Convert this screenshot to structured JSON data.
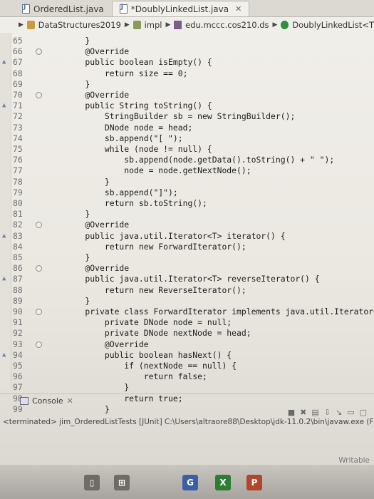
{
  "tabs": [
    {
      "label": "OrderedList.java",
      "active": false
    },
    {
      "label": "*DoublyLinkedList.java",
      "active": true
    }
  ],
  "breadcrumb": [
    "DataStructures2019",
    "impl",
    "edu.mccc.cos210.ds",
    "DoublyLinkedList<T"
  ],
  "code": [
    {
      "n": "65",
      "t": "    }"
    },
    {
      "n": "66",
      "t": "    @Override"
    },
    {
      "n": "67",
      "t": "    public boolean isEmpty() {"
    },
    {
      "n": "68",
      "t": "        return size == 0;"
    },
    {
      "n": "69",
      "t": "    }"
    },
    {
      "n": "70",
      "t": "    @Override"
    },
    {
      "n": "71",
      "t": "    public String toString() {"
    },
    {
      "n": "72",
      "t": "        StringBuilder sb = new StringBuilder();"
    },
    {
      "n": "73",
      "t": "        DNode node = head;"
    },
    {
      "n": "74",
      "t": "        sb.append(\"[ \");"
    },
    {
      "n": "75",
      "t": "        while (node != null) {"
    },
    {
      "n": "76",
      "t": "            sb.append(node.getData().toString() + \" \");"
    },
    {
      "n": "77",
      "t": "            node = node.getNextNode();"
    },
    {
      "n": "78",
      "t": "        }"
    },
    {
      "n": "79",
      "t": "        sb.append(\"]\");"
    },
    {
      "n": "80",
      "t": "        return sb.toString();"
    },
    {
      "n": "81",
      "t": "    }"
    },
    {
      "n": "82",
      "t": "    @Override"
    },
    {
      "n": "83",
      "t": "    public java.util.Iterator<T> iterator() {"
    },
    {
      "n": "84",
      "t": "        return new ForwardIterator();"
    },
    {
      "n": "85",
      "t": "    }"
    },
    {
      "n": "86",
      "t": "    @Override"
    },
    {
      "n": "87",
      "t": "    public java.util.Iterator<T> reverseIterator() {"
    },
    {
      "n": "88",
      "t": "        return new ReverseIterator();"
    },
    {
      "n": "89",
      "t": "    }"
    },
    {
      "n": "90",
      "t": "    private class ForwardIterator implements java.util.Iterator<T> {"
    },
    {
      "n": "91",
      "t": "        private DNode node = null;"
    },
    {
      "n": "92",
      "t": "        private DNode nextNode = head;"
    },
    {
      "n": "93",
      "t": "        @Override"
    },
    {
      "n": "94",
      "t": "        public boolean hasNext() {"
    },
    {
      "n": "95",
      "t": "            if (nextNode == null) {"
    },
    {
      "n": "96",
      "t": "                return false;"
    },
    {
      "n": "97",
      "t": "            }"
    },
    {
      "n": "98",
      "t": "            return true;"
    },
    {
      "n": "99",
      "t": "        }"
    }
  ],
  "console": {
    "tab_label": "Console",
    "output": "<terminated> jim_OrderedListTests [JUnit] C:\\Users\\altraore88\\Desktop\\jdk-11.0.2\\bin\\javaw.exe (Fe"
  },
  "status": {
    "writable": "Writable"
  },
  "taskbar": [
    {
      "name": "G",
      "color": "#3b5ea8"
    },
    {
      "name": "X",
      "color": "#2e7d32"
    },
    {
      "name": "PPT",
      "color": "#b2452b"
    }
  ]
}
